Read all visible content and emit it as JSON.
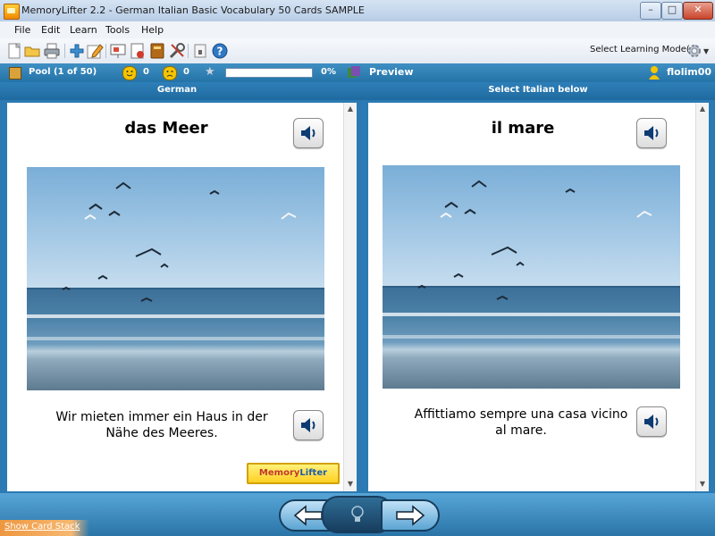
{
  "window": {
    "title": "MemoryLifter 2.2 - German Italian Basic Vocabulary 50 Cards SAMPLE",
    "minimize_glyph": "–",
    "maximize_glyph": "□",
    "close_glyph": "✕"
  },
  "menu": {
    "items": [
      {
        "label": "File"
      },
      {
        "label": "Edit"
      },
      {
        "label": "Learn"
      },
      {
        "label": "Tools"
      },
      {
        "label": "Help"
      }
    ]
  },
  "toolbar": {
    "learning_mode_label": "Select Learning Mode(s)",
    "icons": [
      "new-document-icon",
      "open-folder-icon",
      "print-icon",
      "add-card-icon",
      "edit-card-icon",
      "slideshow-icon",
      "statistics-icon",
      "dictionary-icon",
      "tools-icon",
      "lock-icon",
      "help-icon"
    ]
  },
  "status": {
    "pool_label": "Pool",
    "pool_count": "(1 of 50)",
    "correct_count": "0",
    "wrong_count": "0",
    "progress_text": "0%",
    "progress_value": 0,
    "preview_label": "Preview",
    "username": "flolim00"
  },
  "columns": {
    "left_header": "German",
    "right_header": "Select Italian below"
  },
  "question": {
    "word": "das Meer",
    "sentence": "Wir mieten immer ein Haus in der Nähe des Meeres."
  },
  "answer": {
    "word": "il mare",
    "sentence": "Affittiamo sempre una casa vicino al mare."
  },
  "logo": {
    "text_prefix": "Memory",
    "text_suffix": "Lifter"
  },
  "bottom": {
    "show_card_stack": "Show Card Stack"
  },
  "colors": {
    "accent_blue": "#2b7ab3",
    "status_bar": "#2f80b8",
    "smiley": "#f5c400",
    "progress_fill": "#56b04a"
  }
}
